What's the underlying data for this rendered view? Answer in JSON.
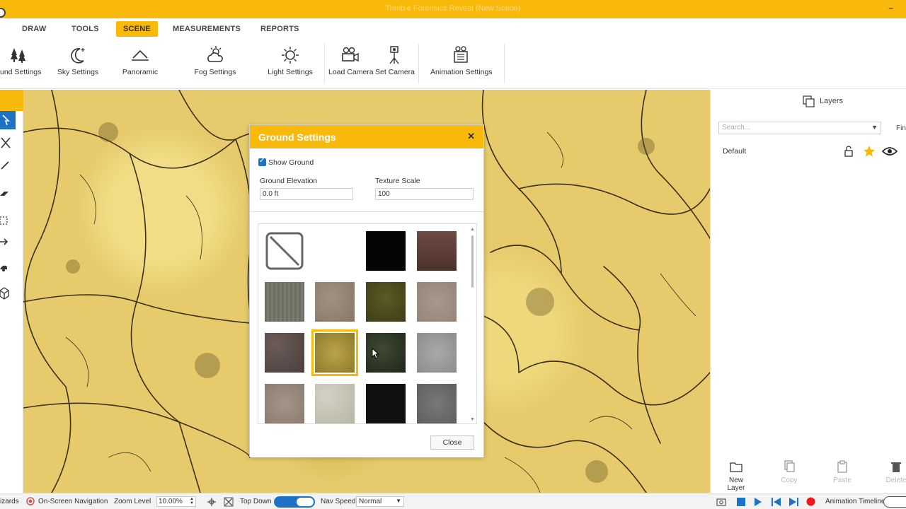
{
  "window": {
    "title": "Trimble Forensics Reveal (New Scene)"
  },
  "menu": [
    "DRAW",
    "TOOLS",
    "SCENE",
    "MEASUREMENTS",
    "REPORTS"
  ],
  "ribbon": {
    "ground": "und Settings",
    "sky": "Sky Settings",
    "panoramic": "Panoramic",
    "fog": "Fog Settings",
    "light": "Light Settings",
    "load_camera": "Load Camera",
    "set_camera": "Set Camera",
    "animation": "Animation Settings"
  },
  "dialog": {
    "title": "Ground Settings",
    "show_ground": "Show Ground",
    "show_ground_checked": true,
    "elevation_label": "Ground Elevation",
    "elevation_value": "0.0 ft",
    "texture_label": "Texture Scale",
    "texture_value": "100",
    "close_label": "Close",
    "selected_swatch_index": 9
  },
  "layers": {
    "header": "Layers",
    "search_placeholder": "Search...",
    "find": "Fin",
    "rows": [
      {
        "name": "Default"
      }
    ],
    "actions": {
      "new_layer": "New Layer",
      "copy": "Copy",
      "paste": "Paste",
      "delete": "Delete"
    }
  },
  "status": {
    "wizards": "izards",
    "onscreen_nav": "On-Screen Navigation",
    "zoom_label": "Zoom Level",
    "zoom_value": "10.00%",
    "view": "Top Down",
    "nav_speed_label": "Nav Speed",
    "nav_speed_value": "Normal",
    "anim_timeline": "Animation Timeline"
  },
  "colors": {
    "accent": "#f9b90b",
    "select_blue": "#1d72c6"
  }
}
